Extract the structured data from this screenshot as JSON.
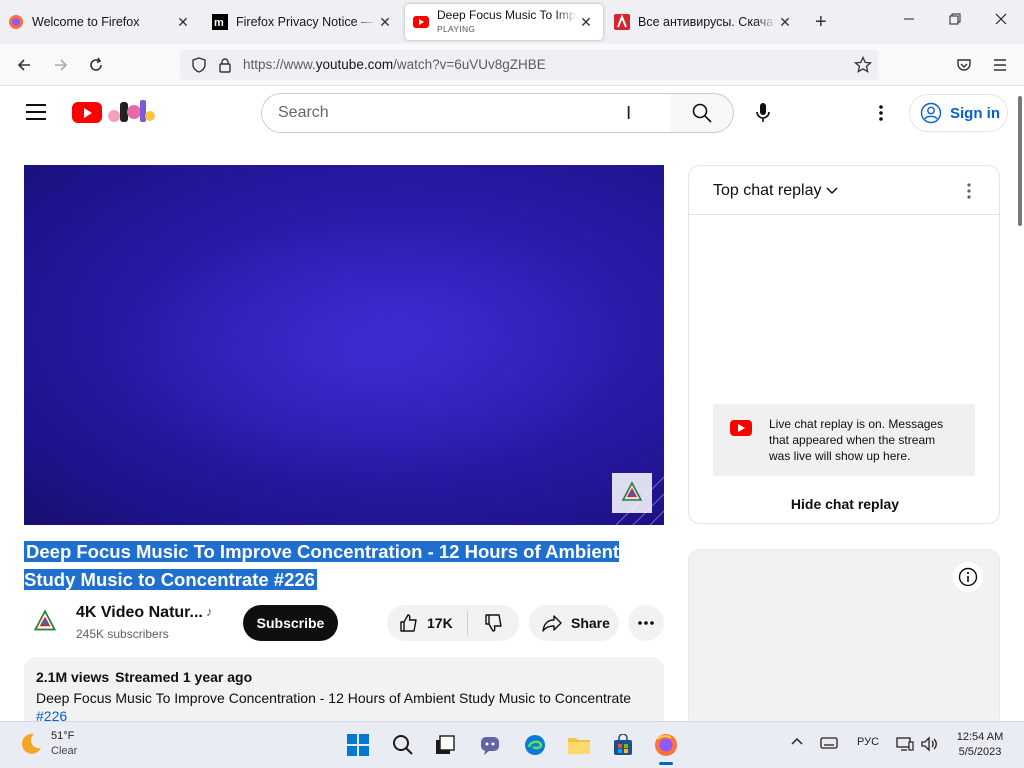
{
  "browser": {
    "tabs": [
      {
        "title": "Welcome to Firefox",
        "close": "✕"
      },
      {
        "title": "Firefox Privacy Notice — Mozilla",
        "close": "✕"
      },
      {
        "title": "Deep Focus Music To Improve Concentration",
        "status": "PLAYING",
        "close": "✕"
      },
      {
        "title": "Все антивирусы. Скачать бесплатно",
        "close": "✕"
      }
    ],
    "new_tab": "+",
    "url_prefix": "https://www.",
    "url_domain": "youtube.com",
    "url_path": "/watch?v=6uVUv8gZHBE"
  },
  "youtube": {
    "search_placeholder": "Search",
    "sign_in": "Sign in"
  },
  "video": {
    "title": "Deep Focus Music To Improve Concentration - 12 Hours of Ambient Study Music to Concentrate #226",
    "channel_name": "4K Video Natur...",
    "channel_note": "♪",
    "subscribers": "245K subscribers",
    "subscribe_label": "Subscribe",
    "likes": "17K",
    "share_label": "Share",
    "views": "2.1M views",
    "streamed": "Streamed 1 year ago",
    "description": "Deep Focus Music To Improve Concentration - 12 Hours of Ambient Study Music to Concentrate",
    "hashtag": "#226"
  },
  "chat": {
    "title": "Top chat replay",
    "notice": "Live chat replay is on. Messages that appeared when the stream was live will show up here.",
    "hide_label": "Hide chat replay"
  },
  "taskbar": {
    "weather_temp": "51°F",
    "weather_cond": "Clear",
    "lang": "РУС",
    "time": "12:54 AM",
    "date": "5/5/2023"
  },
  "colors": {
    "youtube_red": "#ff0000",
    "link_blue": "#065fd4",
    "selection": "#1e6fd0",
    "player_bg": "#2a1aa8"
  }
}
